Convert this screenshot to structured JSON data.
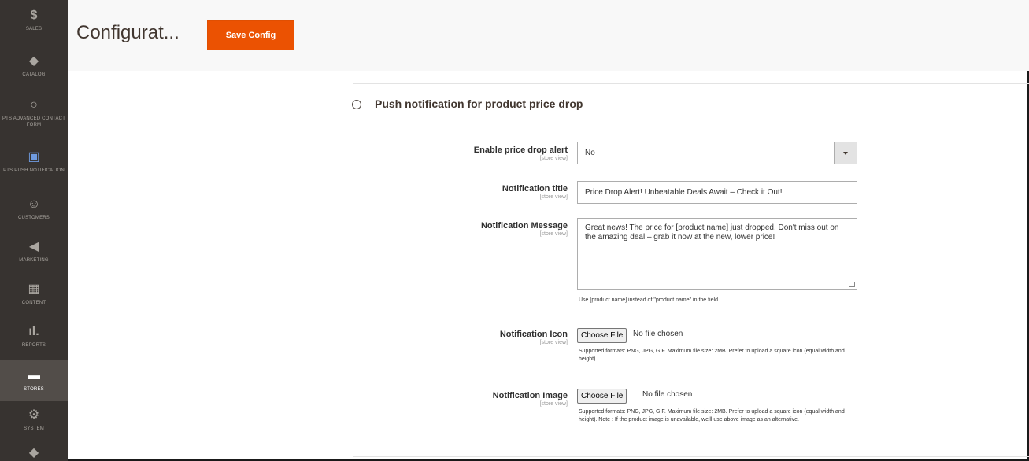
{
  "sidebar": {
    "items": [
      {
        "label": "Sales",
        "icon": "dollar-icon"
      },
      {
        "label": "Catalog",
        "icon": "cube-icon"
      },
      {
        "label": "PTS Advanced Contact Form",
        "icon": "circle-icon"
      },
      {
        "label": "PTS Push Notification",
        "icon": "bell-icon"
      },
      {
        "label": "Customers",
        "icon": "person-icon"
      },
      {
        "label": "Marketing",
        "icon": "megaphone-icon"
      },
      {
        "label": "Content",
        "icon": "layout-icon"
      },
      {
        "label": "Reports",
        "icon": "bar-chart-icon"
      },
      {
        "label": "Stores",
        "icon": "store-icon"
      },
      {
        "label": "System",
        "icon": "gear-icon"
      }
    ]
  },
  "header": {
    "title": "Configurat...",
    "save_label": "Save Config"
  },
  "section": {
    "title": "Push notification for product price drop"
  },
  "fields": {
    "scope": "[store view]",
    "enable": {
      "label": "Enable price drop alert",
      "value": "No"
    },
    "title": {
      "label": "Notification title",
      "value": "Price Drop Alert! Unbeatable Deals Await – Check it Out!"
    },
    "message": {
      "label": "Notification Message",
      "value": "Great news! The price for [product name] just dropped. Don't miss out on the amazing deal – grab it now at the new, lower price!",
      "note": "Use [product name] instead of \"product name\" in the field"
    },
    "icon": {
      "label": "Notification Icon",
      "button": "Choose File",
      "status": "No file chosen",
      "note": "Supported formats: PNG, JPG, GIF. Maximum file size: 2MB. Prefer to upload a square icon (equal width and height)."
    },
    "image": {
      "label": "Notification Image",
      "button": "Choose File",
      "status": "No file chosen",
      "note": "Supported formats: PNG, JPG, GIF. Maximum file size: 2MB. Prefer to upload a square icon (equal width and height). Note : If the product image is unavailable, we'll use above image as an alternative."
    }
  },
  "colors": {
    "sidebar_bg": "#373330",
    "accent": "#eb5202",
    "header_bg": "#f8f8f8"
  }
}
